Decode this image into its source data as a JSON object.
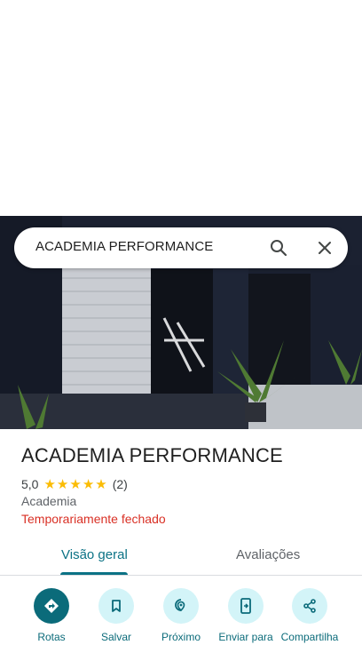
{
  "search": {
    "query": "ACADEMIA PERFORMANCE"
  },
  "place": {
    "name": "ACADEMIA PERFORMANCE",
    "rating": "5,0",
    "stars": 5,
    "review_count": "(2)",
    "category": "Academia",
    "status": "Temporariamente fechado"
  },
  "tabs": [
    {
      "label": "Visão geral",
      "selected": true
    },
    {
      "label": "Avaliações",
      "selected": false
    }
  ],
  "actions": [
    {
      "label": "Rotas",
      "icon": "directions-icon"
    },
    {
      "label": "Salvar",
      "icon": "bookmark-icon"
    },
    {
      "label": "Próximo",
      "icon": "nearby-icon"
    },
    {
      "label": "Enviar para",
      "icon": "send-to-phone-icon"
    },
    {
      "label": "Compartilha",
      "icon": "share-icon"
    }
  ],
  "colors": {
    "accent": "#0b6b7a",
    "status_closed": "#d93025",
    "star": "#fbbc04"
  }
}
